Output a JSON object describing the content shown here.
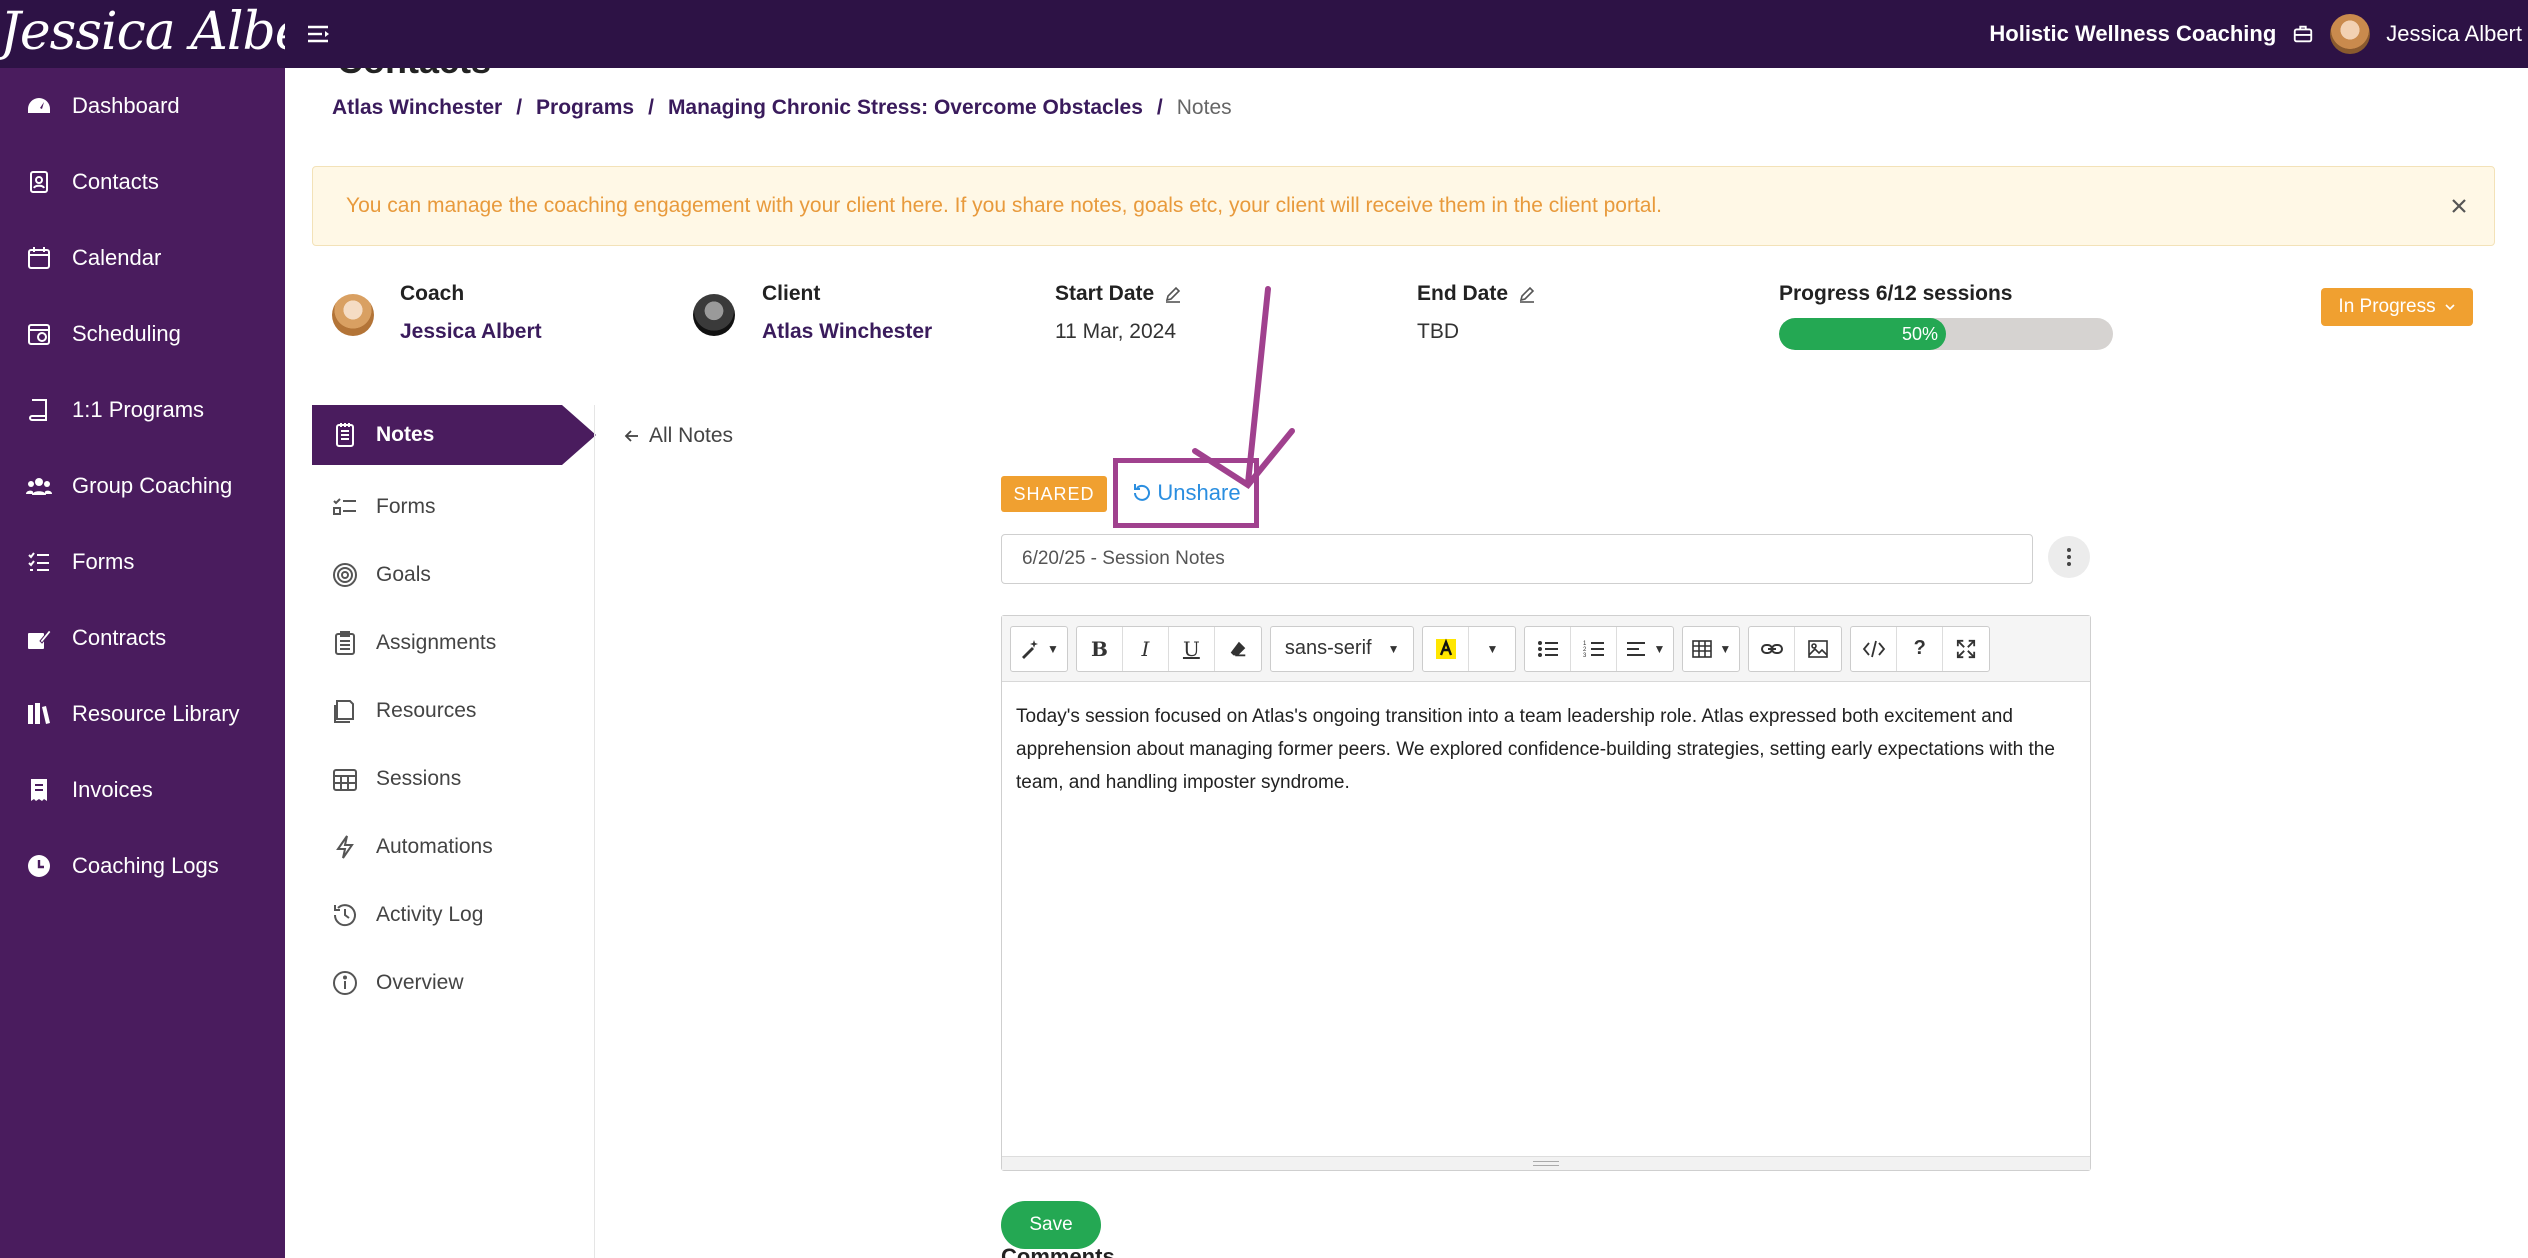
{
  "topbar": {
    "logo_text": "Jessica Albert",
    "org_name": "Holistic Wellness Coaching",
    "user_name": "Jessica Albert"
  },
  "sidebar": {
    "items": [
      {
        "label": "Dashboard",
        "icon": "dashboard-icon"
      },
      {
        "label": "Contacts",
        "icon": "contacts-icon"
      },
      {
        "label": "Calendar",
        "icon": "calendar-icon"
      },
      {
        "label": "Scheduling",
        "icon": "scheduling-icon"
      },
      {
        "label": "1:1 Programs",
        "icon": "book-icon"
      },
      {
        "label": "Group Coaching",
        "icon": "users-icon"
      },
      {
        "label": "Forms",
        "icon": "list-icon"
      },
      {
        "label": "Contracts",
        "icon": "signature-icon"
      },
      {
        "label": "Resource Library",
        "icon": "library-icon"
      },
      {
        "label": "Invoices",
        "icon": "invoice-icon"
      },
      {
        "label": "Coaching Logs",
        "icon": "clock-icon"
      }
    ]
  },
  "page": {
    "title": "Contacts",
    "breadcrumb": [
      "Atlas Winchester",
      "Programs",
      "Managing Chronic Stress: Overcome Obstacles",
      "Notes"
    ],
    "breadcrumb_sep": "/"
  },
  "alert": {
    "text": "You can manage the coaching engagement with your client here. If you share notes, goals etc, your client will receive them in the client portal."
  },
  "engagement": {
    "coach_label": "Coach",
    "coach_name": "Jessica Albert",
    "client_label": "Client",
    "client_name": "Atlas Winchester",
    "start_label": "Start Date",
    "start_value": "11 Mar, 2024",
    "end_label": "End Date",
    "end_value": "TBD",
    "progress_label": "Progress 6/12 sessions",
    "progress_text": "50%",
    "progress_fraction": 0.5,
    "status": "In Progress"
  },
  "subnav": {
    "items": [
      {
        "label": "Notes",
        "icon": "notes-icon"
      },
      {
        "label": "Forms",
        "icon": "checklist-icon"
      },
      {
        "label": "Goals",
        "icon": "target-icon"
      },
      {
        "label": "Assignments",
        "icon": "clipboard-icon"
      },
      {
        "label": "Resources",
        "icon": "resources-icon"
      },
      {
        "label": "Sessions",
        "icon": "calendar-grid-icon"
      },
      {
        "label": "Automations",
        "icon": "bolt-icon"
      },
      {
        "label": "Activity Log",
        "icon": "history-icon"
      },
      {
        "label": "Overview",
        "icon": "info-icon"
      }
    ]
  },
  "note": {
    "back_label": "All Notes",
    "shared_badge": "SHARED",
    "unshare_label": "Unshare",
    "title_value": "6/20/25 - Session Notes",
    "font_name": "sans-serif",
    "body": "Today's session focused on Atlas's ongoing transition into a team leadership role. Atlas expressed both excitement and apprehension about managing former peers. We explored confidence-building strategies, setting early expectations with the team, and handling imposter syndrome.",
    "save_label": "Save",
    "comments_label": "Comments"
  },
  "help": {
    "label": "?"
  },
  "colors": {
    "topbar": "#2d1245",
    "sidebar": "#4a1c5e",
    "accent_orange": "#f0a030",
    "success_green": "#24a853",
    "annotation": "#a0418e"
  }
}
